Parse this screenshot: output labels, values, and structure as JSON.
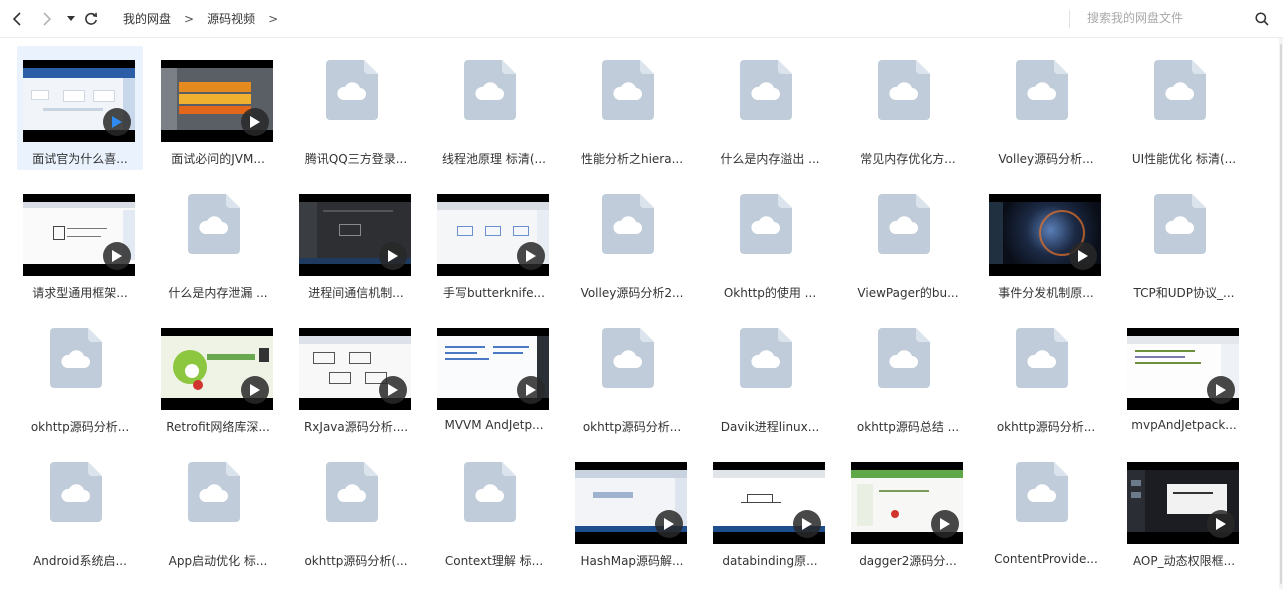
{
  "toolbar": {
    "breadcrumb": [
      "我的网盘",
      "源码视频"
    ],
    "breadcrumb_separator": ">",
    "search_placeholder": "搜索我的网盘文件"
  },
  "files": [
    {
      "name": "面试官为什么喜...",
      "type": "video",
      "thumb": "slides-blue",
      "selected": true
    },
    {
      "name": "面试必问的JVM...",
      "type": "video",
      "thumb": "table-orange"
    },
    {
      "name": "腾讯QQ三方登录...",
      "type": "file"
    },
    {
      "name": "线程池原理 标清(...",
      "type": "file"
    },
    {
      "name": "性能分析之hiera...",
      "type": "file"
    },
    {
      "name": "什么是内存溢出 ...",
      "type": "file"
    },
    {
      "name": "常见内存优化方...",
      "type": "file"
    },
    {
      "name": "Volley源码分析...",
      "type": "file"
    },
    {
      "name": "UI性能优化 标清(...",
      "type": "file"
    },
    {
      "name": "请求型通用框架...",
      "type": "video",
      "thumb": "whiteboard"
    },
    {
      "name": "什么是内存泄漏 ...",
      "type": "file"
    },
    {
      "name": "进程间通信机制...",
      "type": "video",
      "thumb": "dark-ide"
    },
    {
      "name": "手写butterknife...",
      "type": "video",
      "thumb": "diagram"
    },
    {
      "name": "Volley源码分析2...",
      "type": "file"
    },
    {
      "name": "Okhttp的使用 ...",
      "type": "file"
    },
    {
      "name": "ViewPager的bu...",
      "type": "file"
    },
    {
      "name": "事件分发机制原...",
      "type": "video",
      "thumb": "space"
    },
    {
      "name": "TCP和UDP协议_...",
      "type": "file"
    },
    {
      "name": "okhttp源码分析...",
      "type": "file"
    },
    {
      "name": "Retrofit网络库深...",
      "type": "video",
      "thumb": "green-slide"
    },
    {
      "name": "RxJava源码分析....",
      "type": "video",
      "thumb": "uml"
    },
    {
      "name": "MVVM AndJetp...",
      "type": "video",
      "thumb": "code-list"
    },
    {
      "name": "okhttp源码分析...",
      "type": "file"
    },
    {
      "name": "Davik进程linux...",
      "type": "file"
    },
    {
      "name": "okhttp源码总结 ...",
      "type": "file"
    },
    {
      "name": "okhttp源码分析...",
      "type": "file"
    },
    {
      "name": "mvpAndJetpack...",
      "type": "video",
      "thumb": "code-light"
    },
    {
      "name": "Android系统启...",
      "type": "file"
    },
    {
      "name": "App启动优化 标...",
      "type": "file"
    },
    {
      "name": "okhttp源码分析(...",
      "type": "file"
    },
    {
      "name": "Context理解 标...",
      "type": "file"
    },
    {
      "name": "HashMap源码解...",
      "type": "video",
      "thumb": "browser"
    },
    {
      "name": "databinding原...",
      "type": "video",
      "thumb": "sketch"
    },
    {
      "name": "dagger2源码分...",
      "type": "video",
      "thumb": "green-ide"
    },
    {
      "name": "ContentProvide...",
      "type": "file"
    },
    {
      "name": "AOP_动态权限框...",
      "type": "video",
      "thumb": "dark-slides"
    }
  ]
}
